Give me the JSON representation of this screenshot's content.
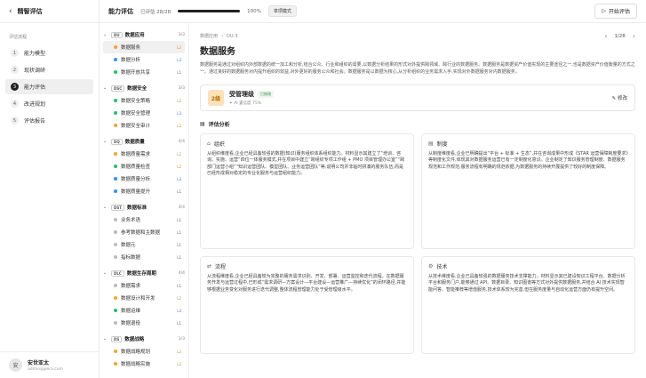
{
  "sidebar": {
    "back_icon": "back-arrow-icon",
    "title": "精智评估",
    "section_label": "评估流程",
    "steps": [
      {
        "num": "1",
        "label": "能力模型"
      },
      {
        "num": "2",
        "label": "现状调研"
      },
      {
        "num": "3",
        "label": "能力评估"
      },
      {
        "num": "4",
        "label": "改进规划"
      },
      {
        "num": "5",
        "label": "评估报告"
      }
    ],
    "user": {
      "avatar": "安",
      "name": "安世亚太",
      "email": "admin@pera.com"
    }
  },
  "topbar": {
    "title": "能力评估",
    "progress_label": "已评估",
    "progress_count": "28/28",
    "progress_value": 100,
    "progress_pct": "100%",
    "mode": "单项模式",
    "start_label": "开始评估"
  },
  "tree": {
    "groups": [
      {
        "code": "DU",
        "name": "数据应用",
        "count": "3/3",
        "items": [
          {
            "name": "数据服务",
            "level": "L2",
            "color": "orange",
            "selected": true
          },
          {
            "name": "数据分析",
            "level": "L3",
            "color": "blue"
          },
          {
            "name": "数据开放共享",
            "level": "L1",
            "color": "green"
          }
        ]
      },
      {
        "code": "DSC",
        "name": "数据安全",
        "count": "3/3",
        "items": [
          {
            "name": "数据安全策略",
            "level": "L2",
            "color": "green"
          },
          {
            "name": "数据安全管理",
            "level": "L3",
            "color": "green"
          },
          {
            "name": "数据安全审计",
            "level": "L2",
            "color": "orange"
          }
        ]
      },
      {
        "code": "DQ",
        "name": "数据质量",
        "count": "4/4",
        "items": [
          {
            "name": "数据质量需求",
            "level": "L2",
            "color": "orange"
          },
          {
            "name": "数据质量检查",
            "level": "L2",
            "color": "green"
          },
          {
            "name": "数据质量分析",
            "level": "L3",
            "color": "blue"
          },
          {
            "name": "数据质量提升",
            "level": "L1",
            "color": "blue"
          }
        ]
      },
      {
        "code": "DST",
        "name": "数据标准",
        "count": "4/4",
        "items": [
          {
            "name": "业务术语",
            "level": "L1",
            "color": "gray"
          },
          {
            "name": "参考数据和主数据",
            "level": "L1",
            "color": "gray"
          },
          {
            "name": "数据元",
            "level": "L1",
            "color": "gray"
          },
          {
            "name": "指标数据",
            "level": "L1",
            "color": "gray"
          }
        ]
      },
      {
        "code": "DLC",
        "name": "数据生存周期",
        "count": "4/4",
        "items": [
          {
            "name": "数据需求",
            "level": "L1",
            "color": "gray"
          },
          {
            "name": "数据设计和开发",
            "level": "L2",
            "color": "orange"
          },
          {
            "name": "数据运维",
            "level": "L3",
            "color": "green"
          },
          {
            "name": "数据退役",
            "level": "L1",
            "color": "gray"
          }
        ]
      },
      {
        "code": "DS",
        "name": "数据战略",
        "count": "3/3",
        "items": [
          {
            "name": "数据战略规划",
            "level": "L2",
            "color": "orange"
          },
          {
            "name": "数据战略实施",
            "level": "L2",
            "color": "orange"
          }
        ]
      }
    ]
  },
  "detail": {
    "breadcrumb": [
      "数据应用",
      "DU-3"
    ],
    "page": "1/28",
    "title": "数据服务",
    "description": "数据服务是通过对组织内外部数据的统一加工和分析,结合公众、行业和组织的需要,以数据分析结果的形式对外提供跨领域、跨行业的数据服务。数据服务是数据资产价值实现的主要途径之一,也是数据资产价值衡量的方式之一。通过良好的数据服务对内提升组织的效益,对外更好的服务公众和社会。数据服务是以数据为核心,从分析组织的业务需求入手,实现对外数据服务对内数据服务。",
    "verdict": {
      "level": "2级",
      "title": "受管理级",
      "tag": "已修改",
      "sub": "AI 置信度 75%",
      "edit_label": "修改"
    },
    "analysis_title": "评估分析",
    "cards": [
      {
        "icon": "org-icon",
        "title": "组织",
        "body": "从组织维度看,企业已经具备较强的数据(知识)服务组织体系组织能力。材料显示其建立了“培训、咨询、实施、运营”四位一体服务模式,并在项目中建立“跨组织专项工作组 + PMO 项目管理办公室”“跨部门运营小组”“知识运营团队、模型团队、业务运营团队”等,说明公司并非临时拼凑的服务队伍,而是已经形成相对稳定的专业化服务与运营组织能力。"
      },
      {
        "icon": "doc-icon",
        "title": "制度",
        "body": "从制度维度看,企业已明确提出“平台 + 标准 + 生态”,并在咨询成果中形成《STAR 运营保障制度要求》等制度化文件,体现其对数据服务运营已有一定制度化意识。企业制定了知识服务管理制度、数据服务规范和工作规范,服务流程有明确的规范依据,为数据服务的持续开展提供了较好的制度保障。"
      },
      {
        "icon": "flow-icon",
        "title": "流程",
        "body": "从流程维度看,企业已经具备较为完整的服务需求识别、开发、部署、运营监控和迭代流程。在数据服务开发与运营过程中,已形成“需求调研—方案设计—平台建设—运营推广—持续优化”的闭环路径,并能够根据业务变化对服务进行迭代调整,整体流程管理能力处于受管理级水平。"
      },
      {
        "icon": "tech-icon",
        "title": "技术",
        "body": "从技术维度看,企业已具备较强的数据服务技术支撑能力。材料显示其已建设知识工程平台、数据分析平台和服务门户,能够通过 API、数据目录、知识图谱等方式对外提供数据服务,并结合 AI 技术实现智能问答、智能推荐等增值服务,技术体系较为完善,但在服务度量与自动化运营方面仍有提升空间。"
      }
    ]
  }
}
